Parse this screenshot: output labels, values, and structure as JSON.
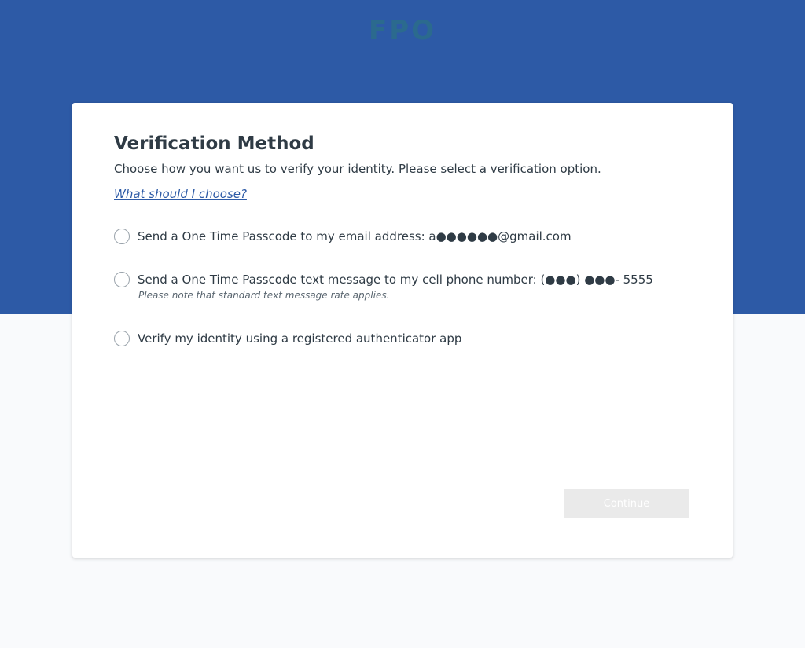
{
  "header": {
    "logo_text": "FPO"
  },
  "card": {
    "title": "Verification Method",
    "subtitle": "Choose how you want us to verify your identity. Please select a verification option.",
    "help_link": "What should I choose?",
    "options": [
      {
        "label": "Send a One Time Passcode to my email address:  a●●●●●●@gmail.com",
        "note": "",
        "selected": false
      },
      {
        "label": "Send a One Time Passcode text message to my cell phone number:  (●●●) ●●●- 5555",
        "note": "Please note that standard text message rate applies.",
        "selected": false
      },
      {
        "label": "Verify my identity using a registered authenticator app",
        "note": "",
        "selected": false
      }
    ],
    "continue_label": "Continue",
    "continue_enabled": false
  },
  "colors": {
    "header_band": "#2d5aa6",
    "page_background": "#f9fafc",
    "card_background": "#ffffff",
    "link": "#2d5aa6",
    "button_disabled": "#eaeaea"
  }
}
